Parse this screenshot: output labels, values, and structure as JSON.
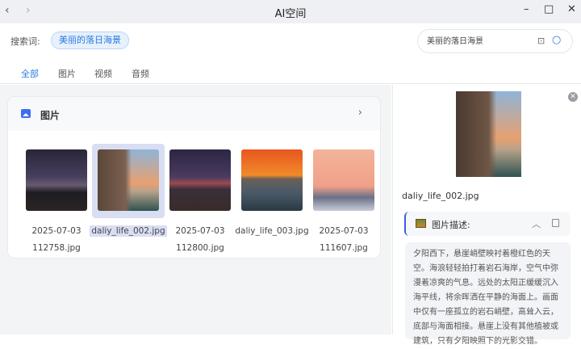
{
  "window": {
    "title": "AI空间",
    "back": "‹",
    "forward": "›",
    "minimize": "–",
    "maximize": "□",
    "close": "✕"
  },
  "search": {
    "label": "搜索词:",
    "chip": "美丽的落日海景",
    "value": "美丽的落日海景",
    "placeholder": "美丽的落日海景"
  },
  "tabs": [
    {
      "label": "全部",
      "active": true
    },
    {
      "label": "图片"
    },
    {
      "label": "视频"
    },
    {
      "label": "音频"
    }
  ],
  "section": {
    "title": "图片",
    "items": [
      {
        "line1": "2025-07-03",
        "line2": "112758.jpg"
      },
      {
        "line1": "daliy_life_002.jpg",
        "line2": "",
        "selected": true
      },
      {
        "line1": "2025-07-03",
        "line2": "112800.jpg"
      },
      {
        "line1": "daliy_life_003.jpg",
        "line2": ""
      },
      {
        "line1": "2025-07-03",
        "line2": "111607.jpg"
      }
    ]
  },
  "detail": {
    "filename": "daliy_life_002.jpg",
    "desc_title": "图片描述:",
    "description": "夕阳西下，悬崖峭壁映衬着橙红色的天空。海浪轻轻拍打着岩石海岸，空气中弥漫着凉爽的气息。远处的太阳正缓缓沉入海平线，将余晖洒在平静的海面上。画面中仅有一座孤立的岩石峭壁，高耸入云，底部与海面相接。悬崖上没有其他植被或建筑，只有夕阳映照下的光影交错。"
  },
  "colors": {
    "accent": "#2a7ae2",
    "selection": "#d9def3"
  }
}
